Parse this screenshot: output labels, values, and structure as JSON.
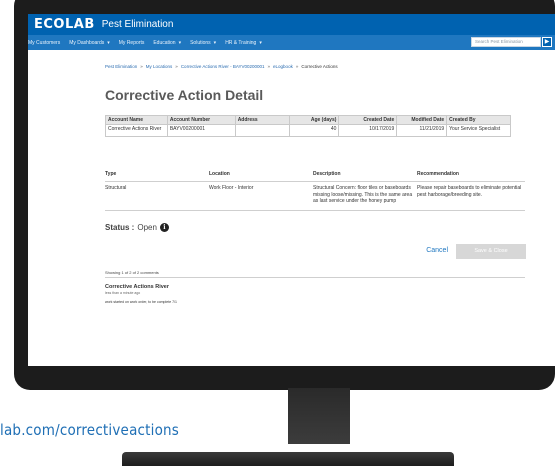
{
  "header": {
    "logo": "ECOLAB",
    "app_name": "Pest Elimination"
  },
  "nav": {
    "items": [
      {
        "label": "My Customers",
        "dropdown": false
      },
      {
        "label": "My Dashboards",
        "dropdown": true
      },
      {
        "label": "My Reports",
        "dropdown": false
      },
      {
        "label": "Education",
        "dropdown": true
      },
      {
        "label": "Solutions",
        "dropdown": true
      },
      {
        "label": "HR & Training",
        "dropdown": true
      }
    ],
    "search_placeholder": "Search Pest Elimination",
    "search_button": "▶"
  },
  "breadcrumb": {
    "items": [
      "Pest Elimination",
      "My Locations",
      "Corrective Actions River - BAYV00200001",
      "eLogbook"
    ],
    "current": "Corrective Actions",
    "separator": "»"
  },
  "page_title": "Corrective Action Detail",
  "account_table": {
    "headers": [
      "Account Name",
      "Account Number",
      "Address",
      "Age (days)",
      "Created Date",
      "Modified Date",
      "Created By"
    ],
    "row": [
      "Corrective Actions River",
      "BAYV00200001",
      "",
      "40",
      "10/17/2019",
      "11/21/2019",
      "Your Service Specialist"
    ]
  },
  "detail": {
    "headers": [
      "Type",
      "Location",
      "Description",
      "Recommendation"
    ],
    "values": [
      "Structural",
      "Work Floor - Interior",
      "Structural Concern: floor tiles or baseboards missing loose/missing. This is the same area as last service under the honey pump",
      "Please repair baseboards to eliminate potential pest harborage/breeding site."
    ]
  },
  "status": {
    "label": "Status :",
    "value": "Open",
    "info_icon": "i"
  },
  "actions": {
    "cancel": "Cancel",
    "save": "Save & Close"
  },
  "comments": {
    "count_text": "Showing 1 of 2 of 2 comments",
    "author": "Corrective Actions River",
    "time": "less than a minute ago",
    "text": "work started on work order, to be complete 7/1"
  },
  "caption": "lab.com/correctiveactions",
  "colors": {
    "brand_blue": "#0062b0",
    "nav_blue": "#1f77c0",
    "link_blue": "#2a6cb0",
    "caption_blue": "#1f6fb5"
  }
}
